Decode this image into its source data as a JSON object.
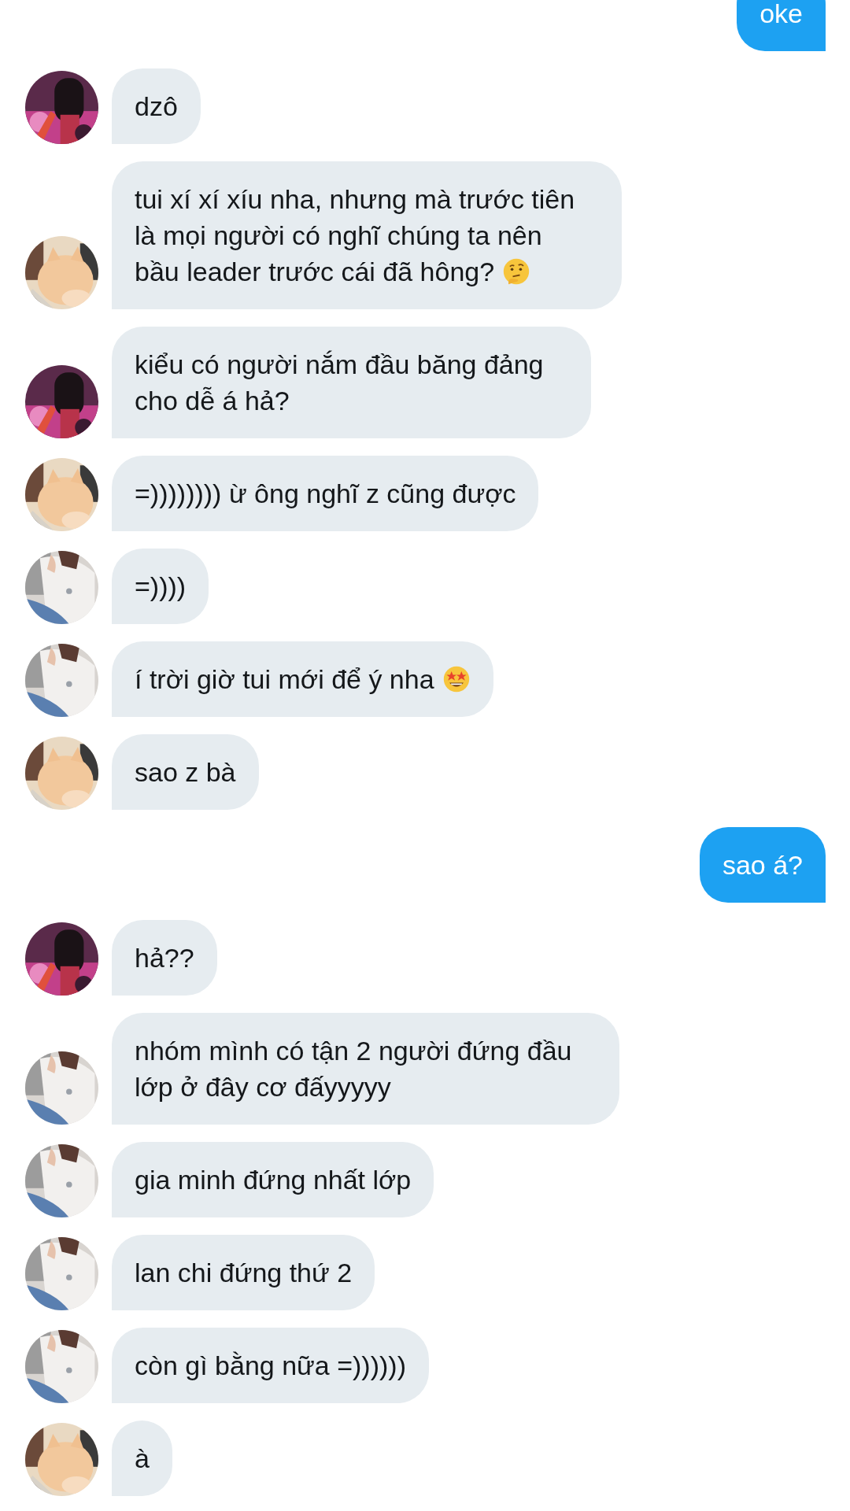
{
  "messages": [
    {
      "kind": "outgoing",
      "lines": [
        "oke"
      ]
    },
    {
      "kind": "incoming",
      "avatar": {
        "kind": "picture"
      },
      "lines": [
        "dzô"
      ]
    },
    {
      "kind": "incoming",
      "avatar": {
        "kind": "picture"
      },
      "lines": [
        "tui xí xí xíu nha, nhưng mà trước tiên",
        "là mọi người có nghĩ chúng ta nên",
        "bầu leader trước cái đã hông?"
      ],
      "emoji": true
    },
    {
      "kind": "incoming",
      "avatar": {
        "kind": "picture"
      },
      "lines": [
        "kiểu có người nắm đầu băng đảng",
        "cho dễ á hả?"
      ]
    },
    {
      "kind": "incoming",
      "avatar": {
        "kind": "picture"
      },
      "lines": [
        "=)))))))) ừ ông nghĩ z cũng được"
      ]
    },
    {
      "kind": "incoming",
      "avatar": {
        "kind": "picture"
      },
      "lines": [
        "=))))"
      ]
    },
    {
      "kind": "incoming",
      "avatar": {
        "kind": "picture"
      },
      "lines": [
        "í trời giờ tui mới để ý nha"
      ],
      "emoji": true
    },
    {
      "kind": "incoming",
      "avatar": {
        "kind": "picture"
      },
      "lines": [
        "sao z bà"
      ]
    },
    {
      "kind": "outgoing",
      "lines": [
        "sao á?"
      ]
    },
    {
      "kind": "incoming",
      "avatar": {
        "kind": "picture"
      },
      "lines": [
        "hả??"
      ]
    },
    {
      "kind": "incoming",
      "avatar": {
        "kind": "picture"
      },
      "lines": [
        "nhóm mình có tận 2 người đứng đầu",
        "lớp ở đây cơ đấyyyyy"
      ]
    },
    {
      "kind": "incoming",
      "avatar": {
        "kind": "picture"
      },
      "lines": [
        "gia minh đứng nhất lớp"
      ]
    },
    {
      "kind": "incoming",
      "avatar": {
        "kind": "picture"
      },
      "lines": [
        "lan chi đứng thứ 2"
      ]
    },
    {
      "kind": "incoming",
      "avatar": {
        "kind": "picture"
      },
      "lines": [
        "còn gì bằng nữa =))))))"
      ]
    },
    {
      "kind": "incoming",
      "avatar": {
        "kind": "picture"
      },
      "lines": [
        "à"
      ]
    }
  ]
}
